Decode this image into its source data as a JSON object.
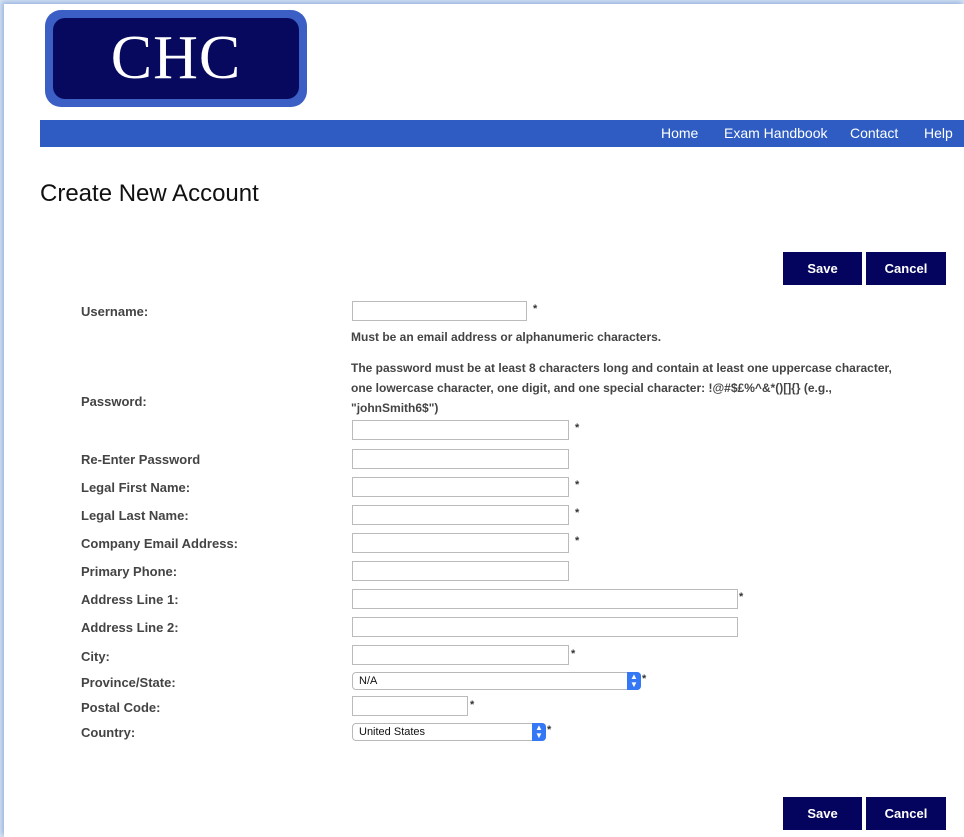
{
  "logo": {
    "text": "CHC"
  },
  "nav": {
    "items": [
      "Home",
      "Exam Handbook",
      "Contact",
      "Help"
    ]
  },
  "page_title": "Create New Account",
  "buttons": {
    "save": "Save",
    "cancel": "Cancel"
  },
  "required_marker": "*",
  "form": {
    "username": {
      "label": "Username:",
      "value": "",
      "hint": "Must be an email address or alphanumeric characters."
    },
    "password": {
      "label": "Password:",
      "value": "",
      "hint_lines": [
        "The password must be at least 8 characters long and contain at least one uppercase character,",
        "one lowercase character, one digit, and one special character: !@#$£%^&*()[]{} (e.g.,",
        "\"johnSmith6$\")"
      ]
    },
    "reenter_password": {
      "label": "Re-Enter Password",
      "value": ""
    },
    "first_name": {
      "label": "Legal First Name:",
      "value": ""
    },
    "last_name": {
      "label": "Legal Last Name:",
      "value": ""
    },
    "company_email": {
      "label": "Company Email Address:",
      "value": ""
    },
    "primary_phone": {
      "label": "Primary Phone:",
      "value": ""
    },
    "address1": {
      "label": "Address Line 1:",
      "value": ""
    },
    "address2": {
      "label": "Address Line 2:",
      "value": ""
    },
    "city": {
      "label": "City:",
      "value": ""
    },
    "province": {
      "label": "Province/State:",
      "selected": "N/A"
    },
    "postal_code": {
      "label": "Postal Code:",
      "value": ""
    },
    "country": {
      "label": "Country:",
      "selected": "United States"
    }
  },
  "colors": {
    "nav_bar": "#2e5cc2",
    "button": "#04045e",
    "logo_border": "#3b5fc4",
    "logo_fill": "#06095e",
    "select_arrow": "#3478f6"
  },
  "icons": {
    "select_arrow": "chevron-up-down-icon"
  }
}
